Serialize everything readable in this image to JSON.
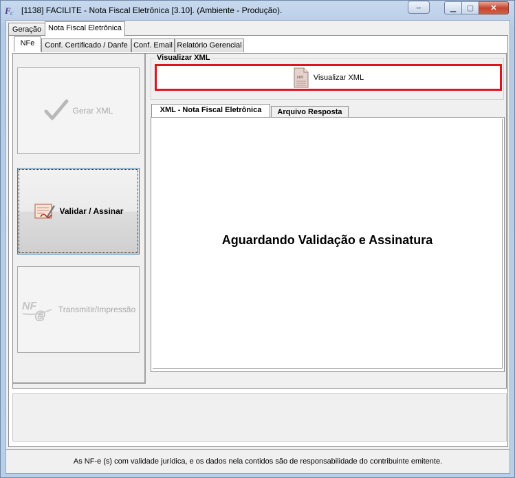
{
  "window": {
    "title": "[1138] FACILITE - Nota Fiscal Eletrônica [3.10]. (Ambiente - Produção).",
    "controls": {
      "minimize": "▁",
      "maximize": "▢",
      "close": "✕",
      "restore": "⇔"
    }
  },
  "main_tabs": [
    {
      "label": "Geração",
      "active": false
    },
    {
      "label": "Nota Fiscal Eletrônica",
      "active": true
    }
  ],
  "sub_tabs": [
    {
      "label": "NFe",
      "active": true
    },
    {
      "label": "Conf. Certificado / Danfe",
      "active": false
    },
    {
      "label": "Conf. Email",
      "active": false
    },
    {
      "label": "Relatório Gerencial",
      "active": false
    }
  ],
  "actions": {
    "gerar_xml": {
      "label": "Gerar XML",
      "icon": "checkmark-icon",
      "enabled": false
    },
    "validar_assinar": {
      "label": "Validar / Assinar",
      "icon": "sign-document-icon",
      "enabled": true
    },
    "transmitir": {
      "label": "Transmitir/Impressão",
      "icon": "nfe-logo-icon",
      "enabled": false
    }
  },
  "visualizar_group": {
    "label": "Visualizar XML",
    "button_label": "Visualizar XML",
    "icon_text": ".xml"
  },
  "content_tabs": [
    {
      "label": "XML - Nota Fiscal Eletrônica",
      "active": true
    },
    {
      "label": "Arquivo Resposta",
      "active": false
    }
  ],
  "status_message": "Aguardando Validação e Assinatura",
  "footer_text": "As NF-e (s) com validade jurídica, e os dados nela contidos são de responsabilidade do contribuinte emitente.",
  "colors": {
    "highlight": "#e0141e",
    "focus_border": "#3c7fb1"
  }
}
